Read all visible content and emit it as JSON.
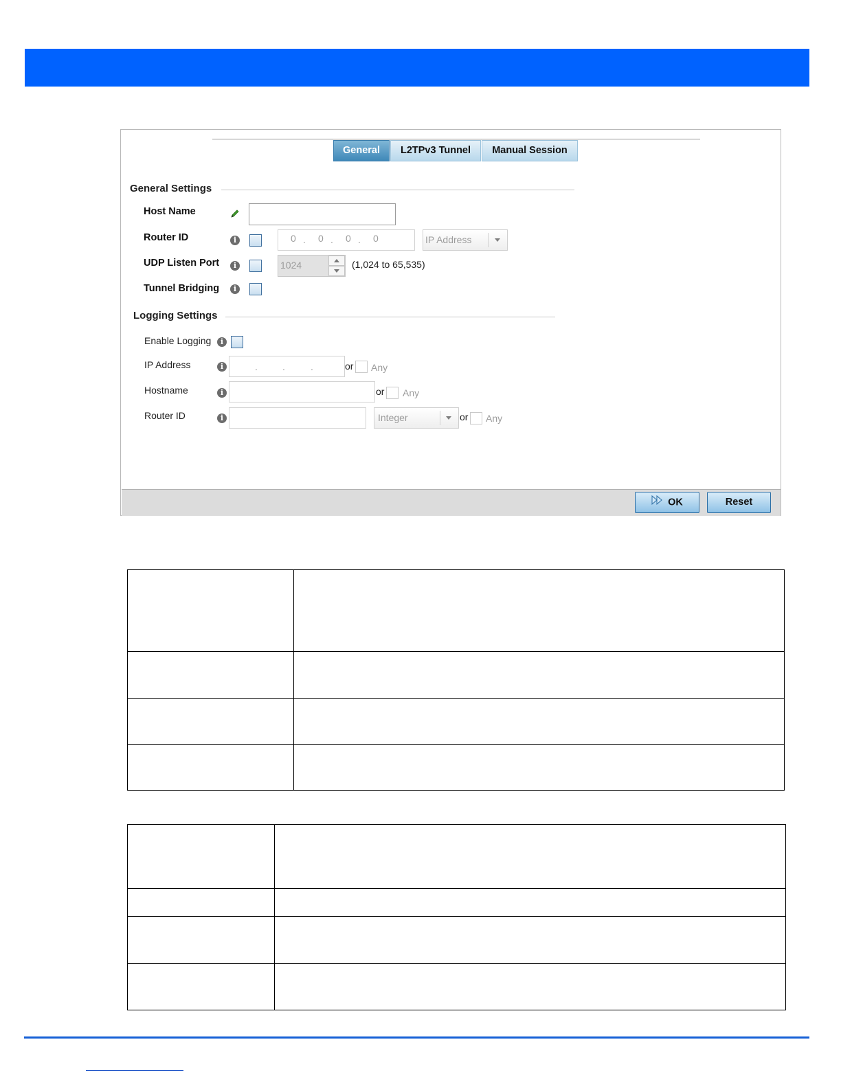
{
  "tabs": [
    {
      "label": "General",
      "active": true
    },
    {
      "label": "L2TPv3 Tunnel",
      "active": false
    },
    {
      "label": "Manual Session",
      "active": false
    }
  ],
  "general_settings": {
    "title": "General Settings",
    "host_name_label": "Host Name",
    "host_name_value": "",
    "router_id_label": "Router ID",
    "router_id_octets": [
      "0",
      "0",
      "0",
      "0"
    ],
    "router_id_type": "IP Address",
    "udp_listen_port_label": "UDP Listen Port",
    "udp_listen_port_value": "1024",
    "udp_range": "(1,024 to 65,535)",
    "tunnel_bridging_label": "Tunnel Bridging"
  },
  "logging_settings": {
    "title": "Logging Settings",
    "enable_logging_label": "Enable Logging",
    "ip_address_label": "IP Address",
    "hostname_label": "Hostname",
    "router_id_label": "Router ID",
    "router_id_type": "Integer",
    "or_label": "or",
    "any_label": "Any"
  },
  "buttons": {
    "ok": "OK",
    "reset": "Reset"
  },
  "colors": {
    "banner": "#0062ff",
    "tab_active": "#3f88b8",
    "footer_rule": "#1560d6"
  }
}
